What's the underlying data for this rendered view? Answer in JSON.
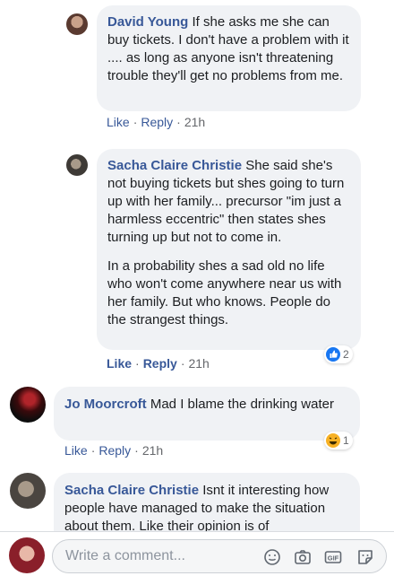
{
  "comments": [
    {
      "author": "David Young",
      "paragraphs": [
        "If she asks me she can buy tickets. I don't have a problem with it .... as long as anyone isn't threatening trouble they'll get no problems from me."
      ],
      "like": "Like",
      "reply": "Reply",
      "time": "21h"
    },
    {
      "author": "Sacha Claire Christie",
      "paragraphs": [
        "She said she's not buying tickets but shes going to turn up with her family... precursor \"im just a harmless eccentric\" then states shes turning up but not to come in.",
        "In a probability shes a sad old no life who won't come anywhere near us with her family. But who knows. People do the strangest things."
      ],
      "like": "Like",
      "reply": "Reply",
      "time": "21h",
      "reaction": {
        "icon": "like-reaction-icon",
        "count": "2"
      }
    },
    {
      "author": "Jo Moorcroft",
      "paragraphs": [
        "Mad I blame the drinking water"
      ],
      "like": "Like",
      "reply": "Reply",
      "time": "21h",
      "reaction": {
        "icon": "haha-reaction-icon",
        "count": "1"
      }
    },
    {
      "author": "Sacha Claire Christie",
      "paragraphs": [
        "Isnt it interesting how people have managed to make the situation about them. Like their opinion is of"
      ]
    }
  ],
  "composer": {
    "placeholder": "Write a comment...",
    "icons": [
      "emoji-icon",
      "camera-icon",
      "gif-icon",
      "sticker-icon"
    ]
  },
  "colors": {
    "link": "#385898",
    "bubble": "#f0f2f5",
    "like_blue": "#1877f2"
  }
}
